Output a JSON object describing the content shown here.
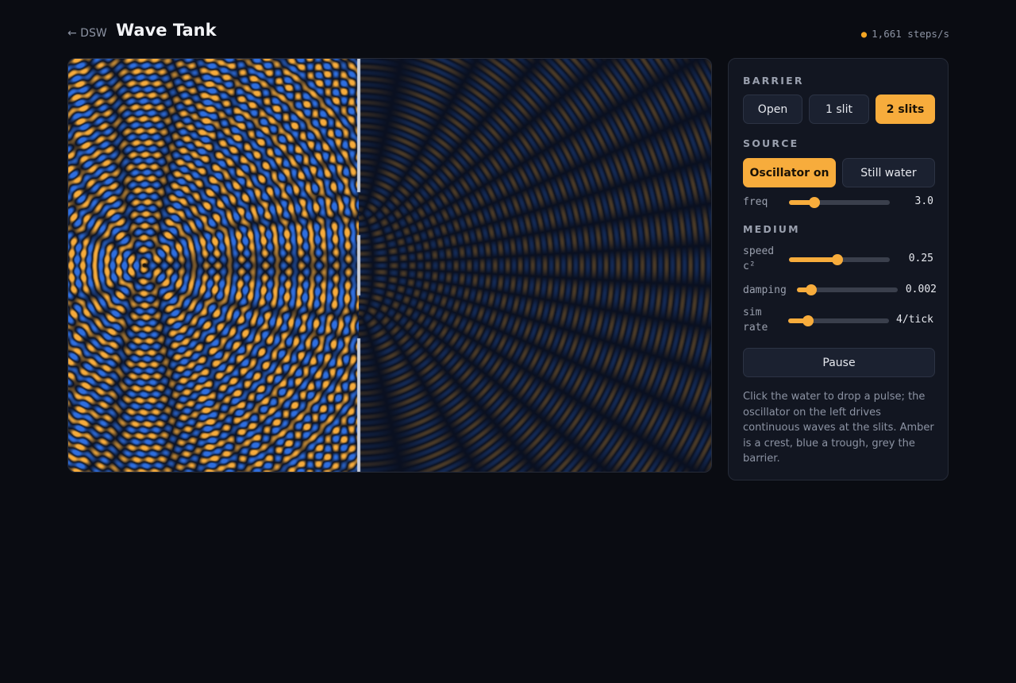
{
  "header": {
    "back_label": "← DSW",
    "title": "Wave Tank",
    "status": "1,661 steps/s"
  },
  "tank": {
    "barrier_mode": "2 slits",
    "crest_color": "#f7ac3c",
    "trough_color": "#2f6fe0",
    "barrier_color": "#c8cdd8"
  },
  "panel": {
    "barrier": {
      "label": "BARRIER",
      "options": [
        "Open",
        "1 slit",
        "2 slits"
      ],
      "selected": "2 slits"
    },
    "source": {
      "label": "SOURCE",
      "oscillator_label": "Oscillator on",
      "still_label": "Still water",
      "selected": "Oscillator on",
      "freq": {
        "label": "freq",
        "value": 3.0,
        "display": "3.0",
        "fraction": 0.25
      }
    },
    "medium": {
      "label": "MEDIUM",
      "speed": {
        "label": "speed c²",
        "value": 0.25,
        "display": "0.25",
        "fraction": 0.48
      },
      "damping": {
        "label": "damping",
        "value": 0.002,
        "display": "0.002",
        "fraction": 0.14
      },
      "sim_rate": {
        "label": "sim rate",
        "value": 4,
        "display": "4/tick",
        "fraction": 0.2
      }
    },
    "pause_label": "Pause",
    "help": "Click the water to drop a pulse; the oscillator on the left drives continuous waves at the slits. Amber is a crest, blue a trough, grey the barrier."
  },
  "colors": {
    "accent": "#f7ac3c",
    "background": "#0a0c12",
    "panel": "#121621"
  }
}
